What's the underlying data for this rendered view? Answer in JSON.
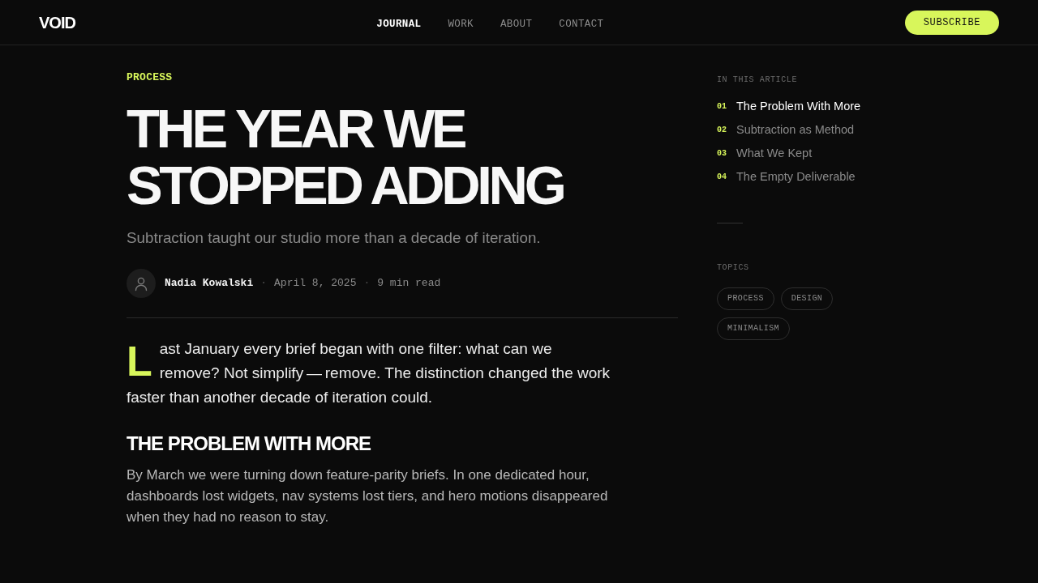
{
  "header": {
    "logo": "VOID",
    "nav": [
      {
        "label": "JOURNAL",
        "selected": true
      },
      {
        "label": "WORK",
        "selected": false
      },
      {
        "label": "ABOUT",
        "selected": false
      },
      {
        "label": "CONTACT",
        "selected": false
      }
    ],
    "subscribe_button": "SUBSCRIBE"
  },
  "article": {
    "category": "PROCESS",
    "title": "THE YEAR WE STOPPED ADDING",
    "subtitle": "Subtraction taught our studio more than a decade of iteration.",
    "byline": [
      {
        "kind": "author",
        "text": "Nadia Kowalski"
      },
      {
        "kind": "separator",
        "text": "·"
      },
      {
        "kind": "meta",
        "text": "April 8, 2025"
      },
      {
        "kind": "separator",
        "text": "·"
      },
      {
        "kind": "meta",
        "text": "9 min read"
      }
    ],
    "body": [
      {
        "kind": "lead",
        "text": "Last January every brief began with one filter: what can we remove? Not simplify — remove. The distinction changed the work faster than another decade of iteration could."
      },
      {
        "kind": "heading",
        "text": "THE PROBLEM WITH MORE"
      },
      {
        "kind": "paragraph",
        "text": "By March we were turning down feature-parity briefs. In one dedicated hour, dashboards lost widgets, nav systems lost tiers, and hero motions disappeared when they had no reason to stay."
      }
    ]
  },
  "sidebar": {
    "toc_label": "IN THIS ARTICLE",
    "toc": [
      {
        "number": "01",
        "title": "The Problem With More",
        "selected": true
      },
      {
        "number": "02",
        "title": "Subtraction as Method",
        "selected": false
      },
      {
        "number": "03",
        "title": "What We Kept",
        "selected": false
      },
      {
        "number": "04",
        "title": "The Empty Deliverable",
        "selected": false
      }
    ],
    "topics_label": "TOPICS",
    "topics": [
      "PROCESS",
      "DESIGN",
      "MINIMALISM"
    ]
  }
}
